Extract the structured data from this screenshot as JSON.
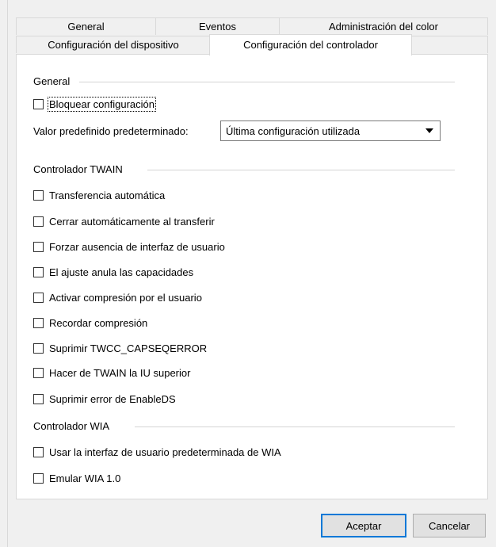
{
  "tabs_row1": [
    {
      "label": "General"
    },
    {
      "label": "Eventos"
    },
    {
      "label": "Administración del color"
    }
  ],
  "tabs_row2": [
    {
      "label": "Configuración del dispositivo"
    },
    {
      "label": "Configuración del controlador",
      "active": true
    }
  ],
  "general": {
    "title": "General",
    "lock_label": "Bloquear configuración",
    "preset_label": "Valor predefinido predeterminado:",
    "preset_value": "Última configuración utilizada"
  },
  "twain": {
    "title": "Controlador TWAIN",
    "items": [
      "Transferencia automática",
      "Cerrar automáticamente al transferir",
      "Forzar ausencia de interfaz de usuario",
      "El ajuste anula las capacidades",
      "Activar compresión por el usuario",
      "Recordar compresión",
      "Suprimir TWCC_CAPSEQERROR",
      "Hacer de TWAIN la IU superior",
      "Suprimir error de EnableDS"
    ]
  },
  "wia": {
    "title": "Controlador WIA",
    "items": [
      "Usar la interfaz de usuario predeterminada de WIA",
      "Emular WIA 1.0"
    ]
  },
  "buttons": {
    "accept": "Aceptar",
    "cancel": "Cancelar"
  }
}
